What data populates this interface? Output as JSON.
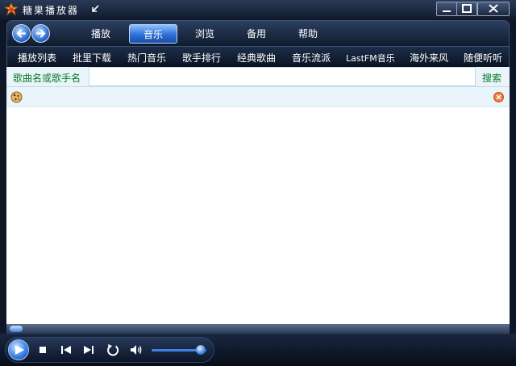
{
  "window": {
    "title": "糖果播放器"
  },
  "nav": {
    "tabs": [
      {
        "label": "播放"
      },
      {
        "label": "音乐"
      },
      {
        "label": "浏览"
      },
      {
        "label": "备用"
      },
      {
        "label": "帮助"
      }
    ],
    "active_tab": "音乐"
  },
  "categories": [
    "播放列表",
    "批里下载",
    "热门音乐",
    "歌手排行",
    "经典歌曲",
    "音乐流派",
    "LastFM音乐",
    "海外来风",
    "随便听听"
  ],
  "search": {
    "label": "歌曲名或歌手名",
    "value": "",
    "button_label": "搜索"
  },
  "player": {
    "progress": 0.0,
    "volume": 0.9
  },
  "colors": {
    "accent": "#2d70d6",
    "search_text": "#0b7a22",
    "list_bg": "#eaf4fb"
  },
  "icons": {
    "app": "candy-app-icon",
    "mini_mode": "mini-mode-icon",
    "back": "back-arrow-icon",
    "forward": "forward-arrow-icon",
    "status": "cookie-icon",
    "close_list": "close-circle-icon",
    "play": "play-icon",
    "stop": "stop-icon",
    "previous": "previous-icon",
    "next": "next-icon",
    "repeat": "repeat-icon",
    "volume": "volume-icon"
  }
}
